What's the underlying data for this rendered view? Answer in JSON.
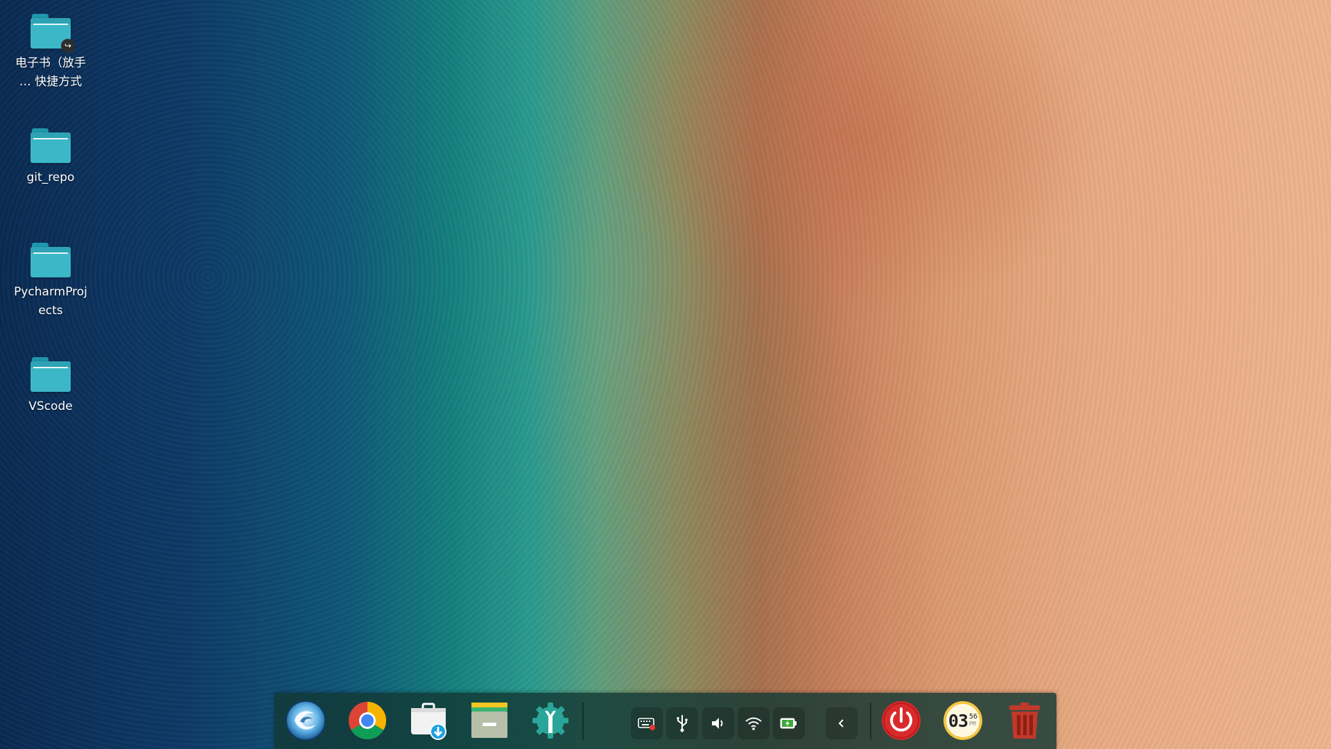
{
  "desktop": {
    "icons": [
      {
        "label": "电子书（放手… 快捷方式",
        "line1": "电子书（放手",
        "line2": "… 快捷方式",
        "icon": "folder-shortcut-icon"
      },
      {
        "label": "git_repo",
        "icon": "folder-icon"
      },
      {
        "label": "PycharmProjects",
        "line1": "PycharmProj",
        "line2": "ects",
        "icon": "folder-icon"
      },
      {
        "label": "VScode",
        "icon": "folder-icon"
      }
    ]
  },
  "dock": {
    "apps": [
      {
        "name": "launcher",
        "icon": "deepin-launcher-icon"
      },
      {
        "name": "chrome",
        "icon": "chrome-icon"
      },
      {
        "name": "app-store",
        "icon": "app-store-icon"
      },
      {
        "name": "file-manager",
        "icon": "file-manager-icon"
      },
      {
        "name": "settings",
        "icon": "settings-icon"
      }
    ],
    "tray": [
      {
        "name": "keyboard",
        "icon": "keyboard-icon"
      },
      {
        "name": "usb",
        "icon": "usb-icon"
      },
      {
        "name": "volume",
        "icon": "volume-icon"
      },
      {
        "name": "wifi",
        "icon": "wifi-icon"
      },
      {
        "name": "battery",
        "icon": "battery-icon"
      },
      {
        "name": "collapse",
        "icon": "chevron-left-icon"
      }
    ],
    "power": {
      "icon": "power-icon"
    },
    "clock": {
      "hour": "03",
      "minute": "56",
      "period": "PM"
    },
    "trash": {
      "icon": "trash-icon"
    }
  },
  "colors": {
    "folder": "#3bb7c8",
    "power": "#d92b2b",
    "trash": "#c0392b",
    "clock_face": "#f4c542",
    "dock_bg": "#123834"
  }
}
